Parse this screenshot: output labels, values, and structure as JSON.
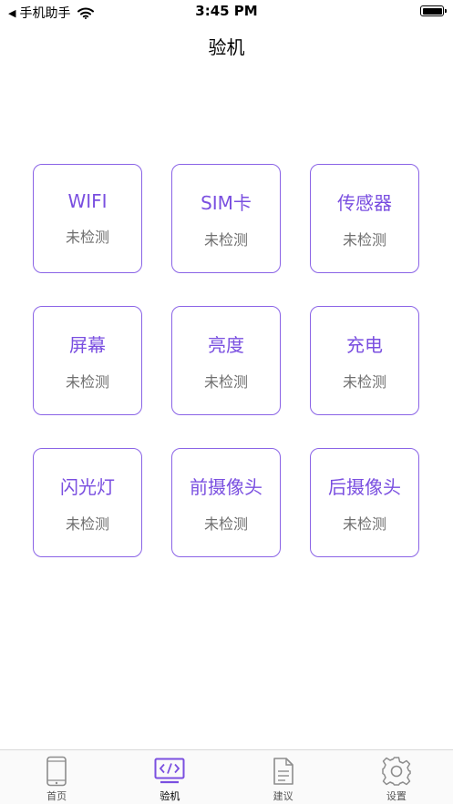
{
  "status_bar": {
    "back_label": "手机助手",
    "time": "3:45 PM"
  },
  "nav": {
    "title": "验机"
  },
  "tiles": [
    {
      "name": "WIFI",
      "status": "未检测"
    },
    {
      "name": "SIM卡",
      "status": "未检测"
    },
    {
      "name": "传感器",
      "status": "未检测"
    },
    {
      "name": "屏幕",
      "status": "未检测"
    },
    {
      "name": "亮度",
      "status": "未检测"
    },
    {
      "name": "充电",
      "status": "未检测"
    },
    {
      "name": "闪光灯",
      "status": "未检测"
    },
    {
      "name": "前摄像头",
      "status": "未检测"
    },
    {
      "name": "后摄像头",
      "status": "未检测"
    }
  ],
  "tab_bar": {
    "tabs": [
      {
        "label": "首页",
        "icon": "phone-icon"
      },
      {
        "label": "验机",
        "icon": "code-icon",
        "active": true
      },
      {
        "label": "建议",
        "icon": "document-icon"
      },
      {
        "label": "设置",
        "icon": "gear-icon"
      }
    ]
  },
  "colors": {
    "accent": "#8a63e6",
    "tile_text": "#7a4fe0",
    "status_text": "#6f6f6f"
  }
}
